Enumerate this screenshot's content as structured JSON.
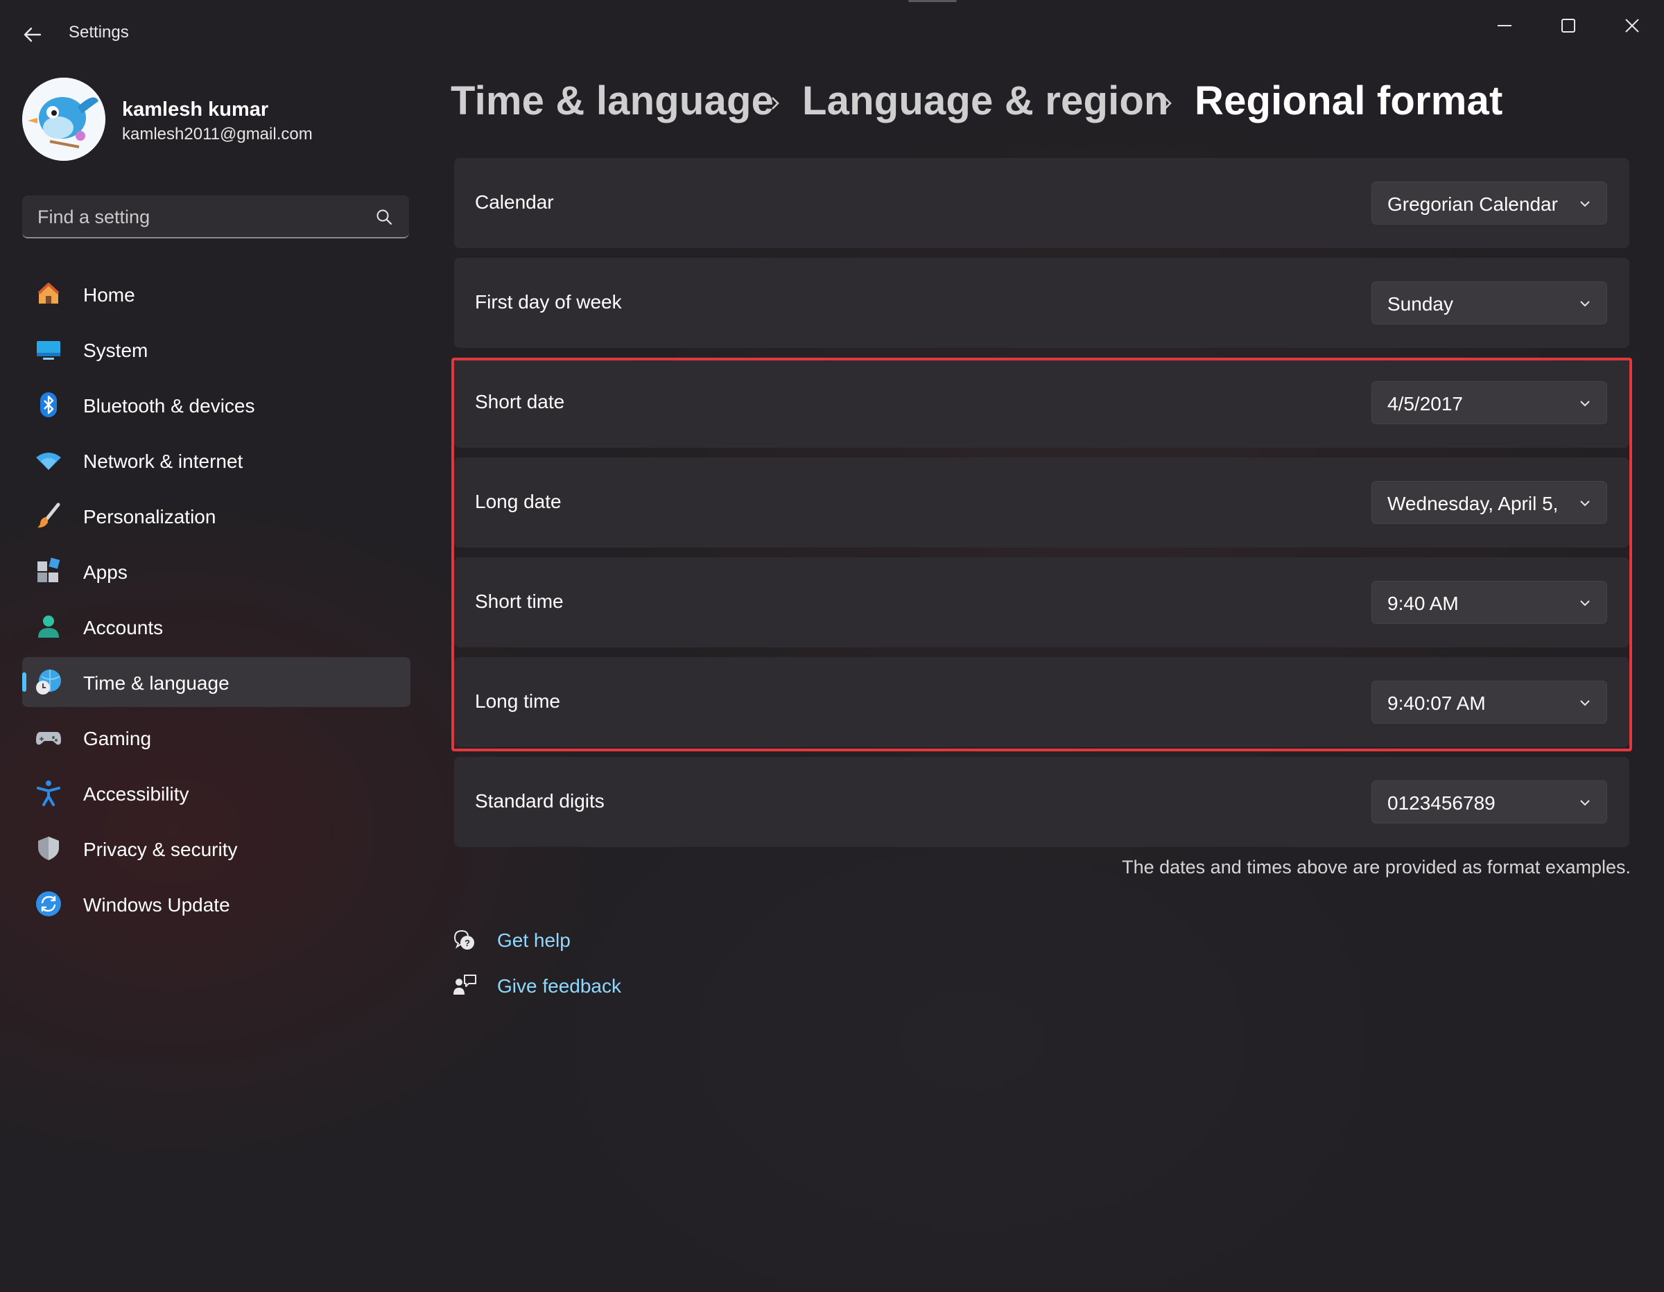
{
  "window": {
    "title": "Settings"
  },
  "profile": {
    "name": "kamlesh kumar",
    "email": "kamlesh2011@gmail.com"
  },
  "search": {
    "placeholder": "Find a setting"
  },
  "sidebar": {
    "items": [
      {
        "label": "Home",
        "icon": "home-icon",
        "active": false
      },
      {
        "label": "System",
        "icon": "system-icon",
        "active": false
      },
      {
        "label": "Bluetooth & devices",
        "icon": "bluetooth-icon",
        "active": false
      },
      {
        "label": "Network & internet",
        "icon": "wifi-icon",
        "active": false
      },
      {
        "label": "Personalization",
        "icon": "brush-icon",
        "active": false
      },
      {
        "label": "Apps",
        "icon": "apps-icon",
        "active": false
      },
      {
        "label": "Accounts",
        "icon": "person-icon",
        "active": false
      },
      {
        "label": "Time & language",
        "icon": "globe-clock-icon",
        "active": true
      },
      {
        "label": "Gaming",
        "icon": "gamepad-icon",
        "active": false
      },
      {
        "label": "Accessibility",
        "icon": "accessibility-icon",
        "active": false
      },
      {
        "label": "Privacy & security",
        "icon": "shield-icon",
        "active": false
      },
      {
        "label": "Windows Update",
        "icon": "update-icon",
        "active": false
      }
    ]
  },
  "breadcrumb": {
    "level1": "Time & language",
    "level2": "Language & region",
    "current": "Regional format"
  },
  "settings": {
    "calendar": {
      "label": "Calendar",
      "value": "Gregorian Calendar"
    },
    "first_day": {
      "label": "First day of week",
      "value": "Sunday"
    },
    "short_date": {
      "label": "Short date",
      "value": "4/5/2017"
    },
    "long_date": {
      "label": "Long date",
      "value": "Wednesday, April 5,"
    },
    "short_time": {
      "label": "Short time",
      "value": "9:40 AM"
    },
    "long_time": {
      "label": "Long time",
      "value": "9:40:07 AM"
    },
    "digits": {
      "label": "Standard digits",
      "value": "0123456789"
    }
  },
  "note": "The dates and times above are provided as format examples.",
  "help": {
    "get_help": "Get help",
    "give_feedback": "Give feedback"
  },
  "colors": {
    "accent": "#4cc2ff",
    "highlight": "#e0383d",
    "link": "#8fd8ff",
    "card": "#2e2c30"
  }
}
